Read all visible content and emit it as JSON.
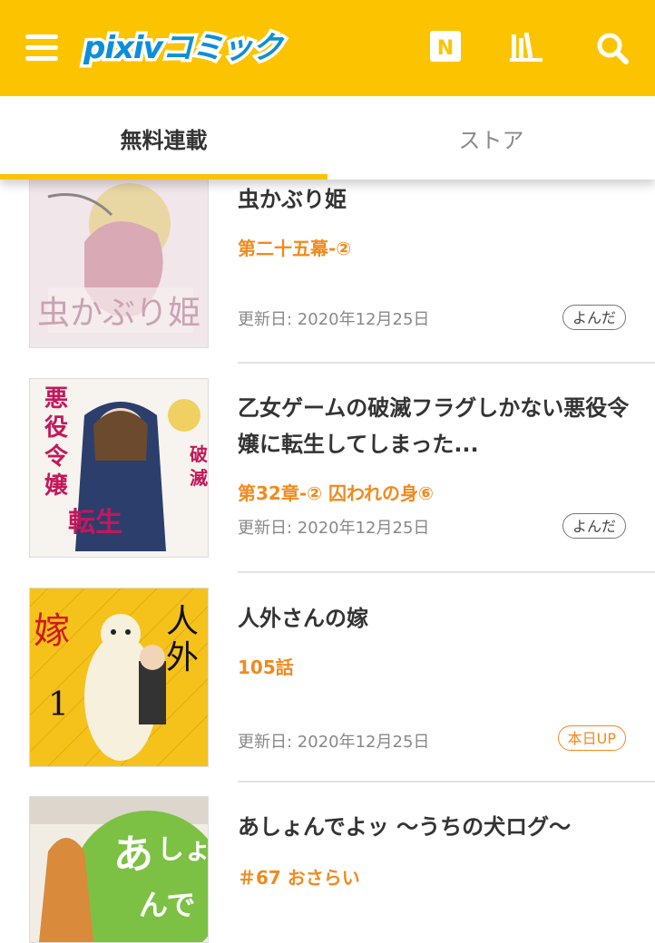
{
  "header": {
    "logo_text": "pixivコミック",
    "news_icon_letter": "N",
    "icons": [
      "menu-icon",
      "news-icon",
      "bookshelf-icon",
      "search-icon"
    ]
  },
  "tabs": [
    {
      "label": "無料連載",
      "active": true
    },
    {
      "label": "ストア",
      "active": false
    }
  ],
  "items": [
    {
      "title": "虫かぶり姫",
      "episode": "第二十五幕-②",
      "date": "更新日: 2020年12月25日",
      "badge": "よんだ",
      "badge_type": "read"
    },
    {
      "title": "乙女ゲームの破滅フラグしかない悪役令嬢に転生してしまった...",
      "episode": "第32章-② 囚われの身⑥",
      "date": "更新日: 2020年12月25日",
      "badge": "よんだ",
      "badge_type": "read"
    },
    {
      "title": "人外さんの嫁",
      "episode": "105話",
      "date": "更新日: 2020年12月25日",
      "badge": "本日UP",
      "badge_type": "new"
    },
    {
      "title": "あしょんでよッ 〜うちの犬ログ〜",
      "episode": "＃67 おさらい",
      "date": "",
      "badge": "",
      "badge_type": ""
    }
  ],
  "colors": {
    "brand": "#fcc400",
    "logo_blue": "#0a8fe0",
    "accent": "#f08a1e"
  }
}
